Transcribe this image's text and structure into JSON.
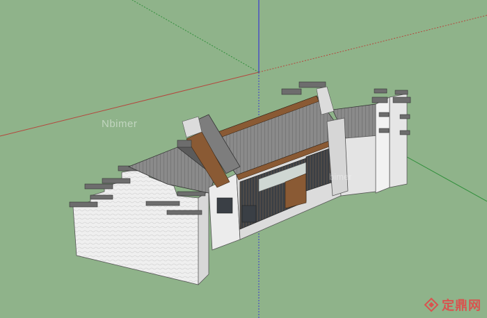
{
  "viewport": {
    "background": "#8fb38a",
    "axis_colors": {
      "red": "#b5463c",
      "green": "#2f8f3a",
      "blue": "#3a3ad0"
    }
  },
  "watermark": {
    "left_text": "Nbimer",
    "right_text": "bimer"
  },
  "brand": {
    "text": "定鼎网",
    "color": "#d9534f",
    "icon": "diamond-logo-icon"
  },
  "colors": {
    "roof_gray": "#7d7d7d",
    "roof_dark": "#5b5b5b",
    "wall_white": "#ececec",
    "wood_brown": "#8a5a34",
    "window_dark": "#3a3f45",
    "glass_light": "#cfd7d3"
  }
}
